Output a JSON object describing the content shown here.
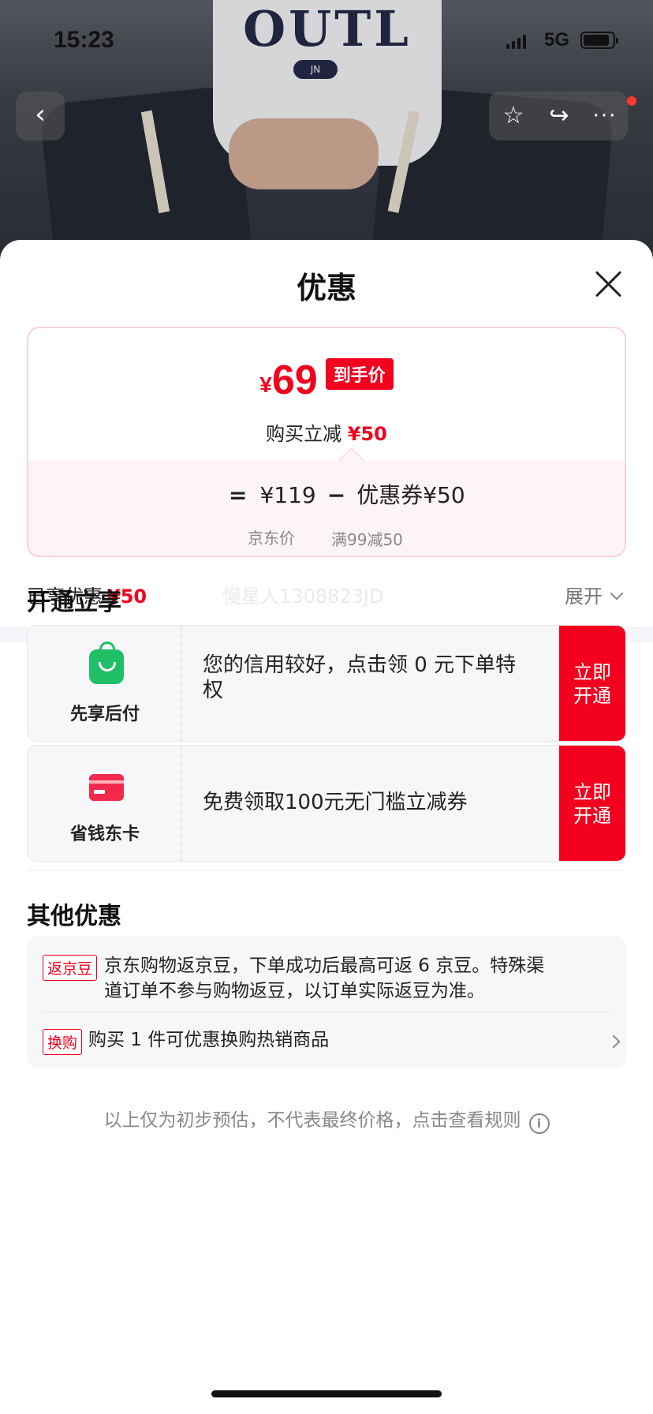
{
  "status_bar": {
    "time": "15:23",
    "network": "5G"
  },
  "photo": {
    "shirt_letters": "OUTL",
    "shirt_badge": "JN"
  },
  "nav": {
    "back_icon": "chevron-left-icon",
    "actions": [
      "star-icon",
      "share-icon",
      "more-icon"
    ]
  },
  "sheet": {
    "title": "优惠",
    "price_card": {
      "currency": "¥",
      "final_price": "69",
      "final_tag": "到手价",
      "subtitle_prefix": "购买立减",
      "subtitle_amount": "¥50",
      "equals": "=",
      "base_price": "¥119",
      "minus": "−",
      "coupon": "优惠券¥50",
      "base_label": "京东价",
      "coupon_label": "满99减50"
    },
    "enjoyed_label": "已享优惠",
    "enjoyed_amount": "¥50",
    "expand_label": "展开",
    "open_section": {
      "title": "开通立享",
      "watermark": "慢星人1308823JD",
      "cards": [
        {
          "name": "先享后付",
          "icon": "shopping-bag-icon",
          "text": "您的信用较好，点击领 0 元下单特权",
          "button_line1": "立即",
          "button_line2": "开通"
        },
        {
          "name": "省钱东卡",
          "icon": "credit-card-icon",
          "text": "免费领取100元无门槛立减券",
          "button_line1": "立即",
          "button_line2": "开通"
        }
      ]
    },
    "other_section": {
      "title": "其他优惠",
      "rows": [
        {
          "tag": "返京豆",
          "text": "京东购物返京豆，下单成功后最高可返 6 京豆。特殊渠道订单不参与购物返豆，以订单实际返豆为准。"
        },
        {
          "tag": "换购",
          "text": "购买 1 件可优惠换购热销商品"
        }
      ]
    },
    "footer_note": "以上仅为初步预估，不代表最终价格，点击查看规则",
    "colors": {
      "accent_red": "#f2001d",
      "green": "#1fbf66"
    }
  }
}
